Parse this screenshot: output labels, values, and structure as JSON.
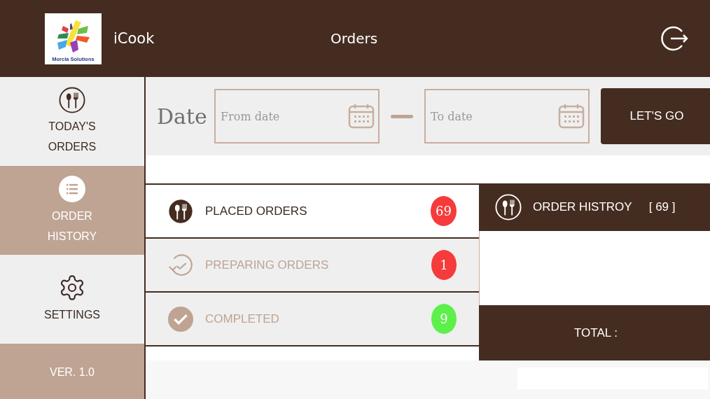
{
  "header": {
    "logo_text": "Morcla Solutions",
    "app_name": "iCook",
    "title": "Orders"
  },
  "sidebar": {
    "items": [
      {
        "kind": "orders",
        "label": "TODAY'S ORDERS",
        "selected": false
      },
      {
        "kind": "history",
        "label": "ORDER HISTORY",
        "selected": true
      },
      {
        "kind": "settings",
        "label": "SETTINGS",
        "selected": false
      }
    ],
    "version": "VER. 1.0"
  },
  "filter": {
    "label": "Date",
    "from": {
      "placeholder": "From date"
    },
    "to": {
      "placeholder": "To date"
    },
    "button": "LET'S GO"
  },
  "statuses": [
    {
      "kind": "placed",
      "label": "PLACED ORDERS",
      "count": "69",
      "color": "#f53b3b",
      "selected": true
    },
    {
      "kind": "preparing",
      "label": "PREPARING ORDERS",
      "count": "1",
      "color": "#f53b3b",
      "selected": false
    },
    {
      "kind": "completed",
      "label": "COMPLETED",
      "count": "9",
      "color": "#5ef04a",
      "selected": false
    }
  ],
  "history": {
    "title": "ORDER HISTROY",
    "count": "[ 69 ]",
    "total_label": "TOTAL :"
  }
}
